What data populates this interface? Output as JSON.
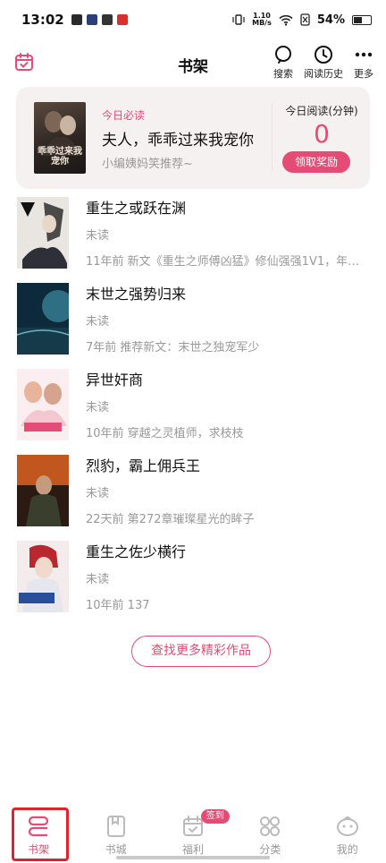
{
  "status_bar": {
    "time": "13:02",
    "net_speed_value": "1.10",
    "net_speed_unit": "MB/s",
    "battery": "54%"
  },
  "header": {
    "title": "书架",
    "actions": [
      {
        "label": "搜索",
        "icon": "search-icon"
      },
      {
        "label": "阅读历史",
        "icon": "clock-icon"
      },
      {
        "label": "更多",
        "icon": "more-dots-icon"
      }
    ]
  },
  "featured": {
    "tag": "今日必读",
    "title": "夫人，乖乖过来我宠你",
    "recommend": "小编姨妈笑推荐~",
    "cover_text": "乖乖过来我宠你",
    "read_label": "今日阅读(分钟)",
    "read_minutes": "0",
    "reward_button": "领取奖励"
  },
  "books": [
    {
      "title": "重生之或跃在渊",
      "status": "未读",
      "update": "11年前 新文《重生之师傅凶猛》修仙强强1V1，年…"
    },
    {
      "title": "末世之强势归来",
      "status": "未读",
      "update": "7年前 推荐新文：末世之独宠军少"
    },
    {
      "title": "异世奸商",
      "status": "未读",
      "update": "10年前 穿越之灵植师，求枝枝"
    },
    {
      "title": "烈豹，霸上佣兵王",
      "status": "未读",
      "update": "22天前 第272章璀璨星光的眸子"
    },
    {
      "title": "重生之佐少横行",
      "status": "未读",
      "update": "10年前 137"
    }
  ],
  "more_button": "查找更多精彩作品",
  "bottom_nav": [
    {
      "label": "书架",
      "active": true
    },
    {
      "label": "书城",
      "active": false
    },
    {
      "label": "福利",
      "active": false,
      "badge": "签到"
    },
    {
      "label": "分类",
      "active": false
    },
    {
      "label": "我的",
      "active": false
    }
  ],
  "colors": {
    "accent": "#e44c76",
    "highlight_box": "#e0222d",
    "muted_text": "#999999"
  }
}
